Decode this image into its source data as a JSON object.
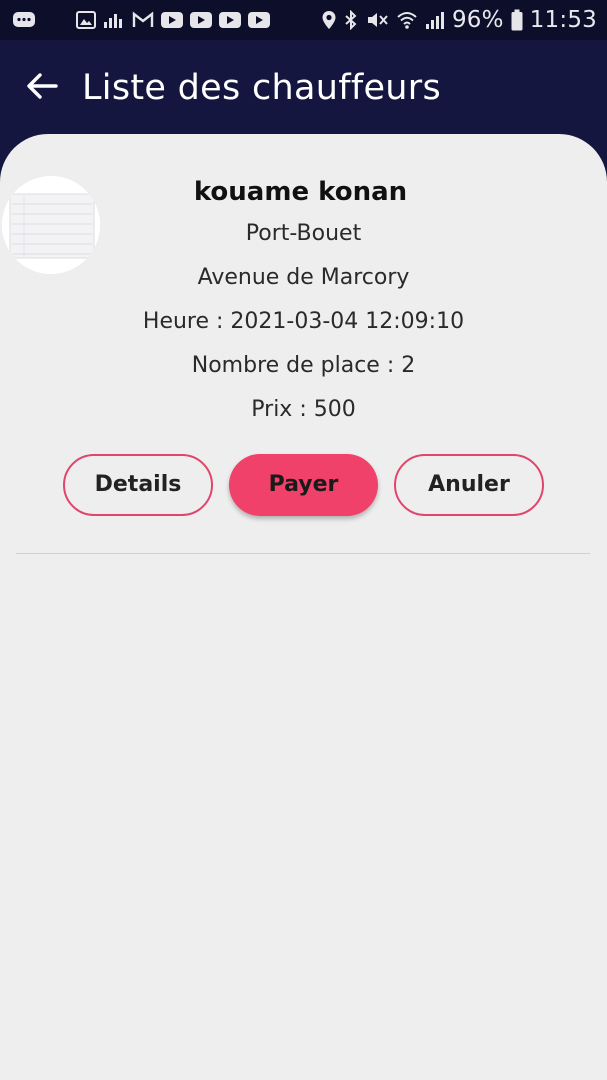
{
  "status_bar": {
    "battery": "96%",
    "time": "11:53"
  },
  "app_bar": {
    "title": "Liste des chauffeurs",
    "back_icon": "arrow-left-icon"
  },
  "driver_card": {
    "name": "kouame konan",
    "departure": "Port-Bouet",
    "destination": "Avenue de Marcory",
    "time_text": "Heure : 2021-03-04 12:09:10",
    "seats_text": "Nombre de place : 2",
    "price_text": "Prix : 500",
    "actions": {
      "details_label": "Details",
      "pay_label": "Payer",
      "cancel_label": "Anuler"
    }
  },
  "colors": {
    "app_bar_bg": "#141640",
    "content_bg": "#eeeeee",
    "accent": "#ef4169"
  }
}
